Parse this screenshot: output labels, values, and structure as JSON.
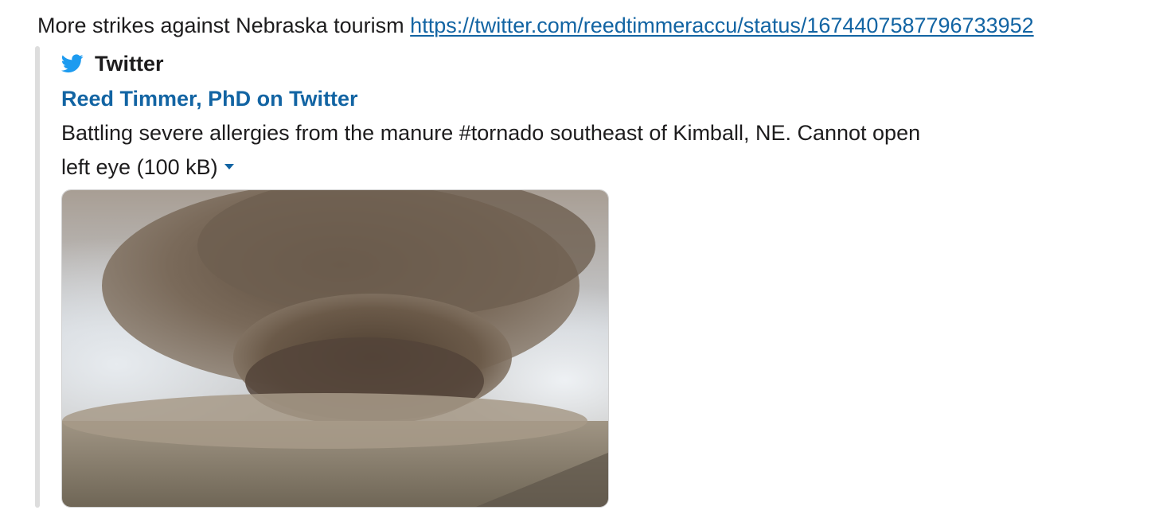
{
  "message": {
    "text": "More strikes against Nebraska tourism ",
    "link": "https://twitter.com/reedtimmeraccu/status/1674407587796733952"
  },
  "attachment": {
    "service": {
      "name": "Twitter",
      "icon": "twitter-bird-icon",
      "icon_color": "#1d9bf0"
    },
    "title": "Reed Timmer, PhD on Twitter",
    "text": "Battling severe allergies from the manure #tornado southeast of Kimball, NE. Cannot open left eye",
    "file_size": "(100 kB)",
    "media": {
      "description": "dust tornado over a field",
      "kind": "image"
    }
  },
  "colors": {
    "link": "#1264a3",
    "text": "#1d1c1d",
    "attachment_bar": "#dddddd"
  }
}
